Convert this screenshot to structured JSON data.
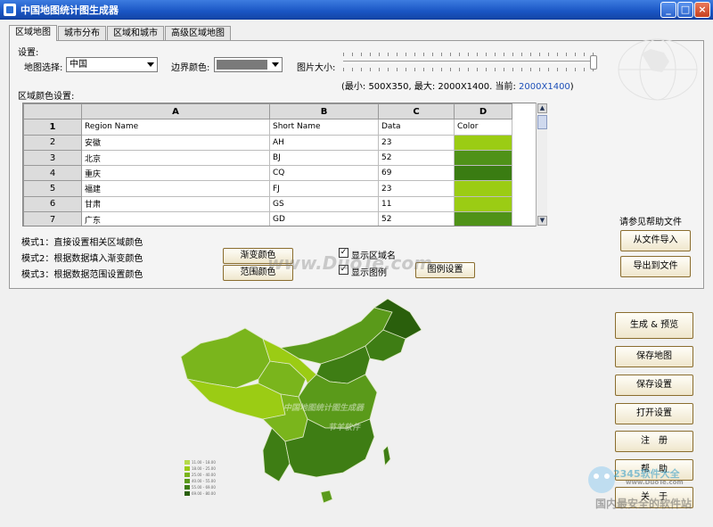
{
  "window": {
    "title": "中国地图统计图生成器",
    "min": "_",
    "max": "□",
    "close": "×"
  },
  "tabs": [
    "区域地图",
    "城市分布",
    "区域和城市",
    "高级区域地图"
  ],
  "settings": {
    "label": "设置:",
    "map_select_label": "地图选择:",
    "map_select_value": "中国",
    "border_color_label": "边界颜色:",
    "border_color_value": "#7a7a7a",
    "image_size_label": "图片大小:",
    "size_info": "(最小: 500X350, 最大: 2000X1400. 当前:",
    "size_current": "2000X1400",
    "size_close": ")",
    "slider_value": 1.0
  },
  "region_color_label": "区域颜色设置:",
  "grid": {
    "col_headers": [
      "A",
      "B",
      "C",
      "D"
    ],
    "rows": [
      {
        "n": "1",
        "name": "Region Name",
        "short": "AH",
        "data": "Data",
        "color": "Color",
        "header": true
      },
      {
        "n": "2",
        "name": "安徽",
        "short": "AH",
        "data": "23",
        "color": "#9bcc14"
      },
      {
        "n": "3",
        "name": "北京",
        "short": "BJ",
        "data": "52",
        "color": "#4f9218"
      },
      {
        "n": "4",
        "name": "重庆",
        "short": "CQ",
        "data": "69",
        "color": "#3a7c12"
      },
      {
        "n": "5",
        "name": "福建",
        "short": "FJ",
        "data": "23",
        "color": "#9bcc14"
      },
      {
        "n": "6",
        "name": "甘肃",
        "short": "GS",
        "data": "11",
        "color": "#9bcc14"
      },
      {
        "n": "7",
        "name": "广东",
        "short": "GD",
        "data": "52",
        "color": "#4f9218"
      }
    ],
    "row1_short": "Short Name"
  },
  "modes": {
    "mode1": "模式1：直接设置相关区域颜色",
    "mode2": "模式2：根据数据填入渐变颜色",
    "mode3": "模式3：根据数据范围设置颜色",
    "gradient_btn": "渐变颜色",
    "range_btn": "范围颜色",
    "show_name": "显示区域名",
    "show_legend": "显示图例",
    "legend_settings": "图例设置",
    "check_mark": "✓"
  },
  "help_text": "请参见帮助文件",
  "file_buttons": {
    "import": "从文件导入",
    "export": "导出到文件"
  },
  "actions": [
    "生成 & 预览",
    "保存地图",
    "保存设置",
    "打开设置",
    "注　册",
    "帮　助",
    "关　于"
  ],
  "watermarks": {
    "center": "www.DuoTe.com",
    "map1": "中国地图统计图生成器",
    "map2": "节羊软件",
    "corner1": "2345软件大全",
    "corner2": "www.DuoTe.com",
    "corner3": "国内最安全的软件站"
  },
  "legend_colors": [
    "#b6da4a",
    "#9bcc14",
    "#7ab51c",
    "#5a9a1a",
    "#3e7d14",
    "#2a5f0c"
  ],
  "legend_labels": [
    "11.00 - 18.00",
    "18.00 - 25.00",
    "25.00 - 40.00",
    "40.00 - 55.00",
    "55.00 - 69.00",
    "69.00 - 80.00"
  ]
}
